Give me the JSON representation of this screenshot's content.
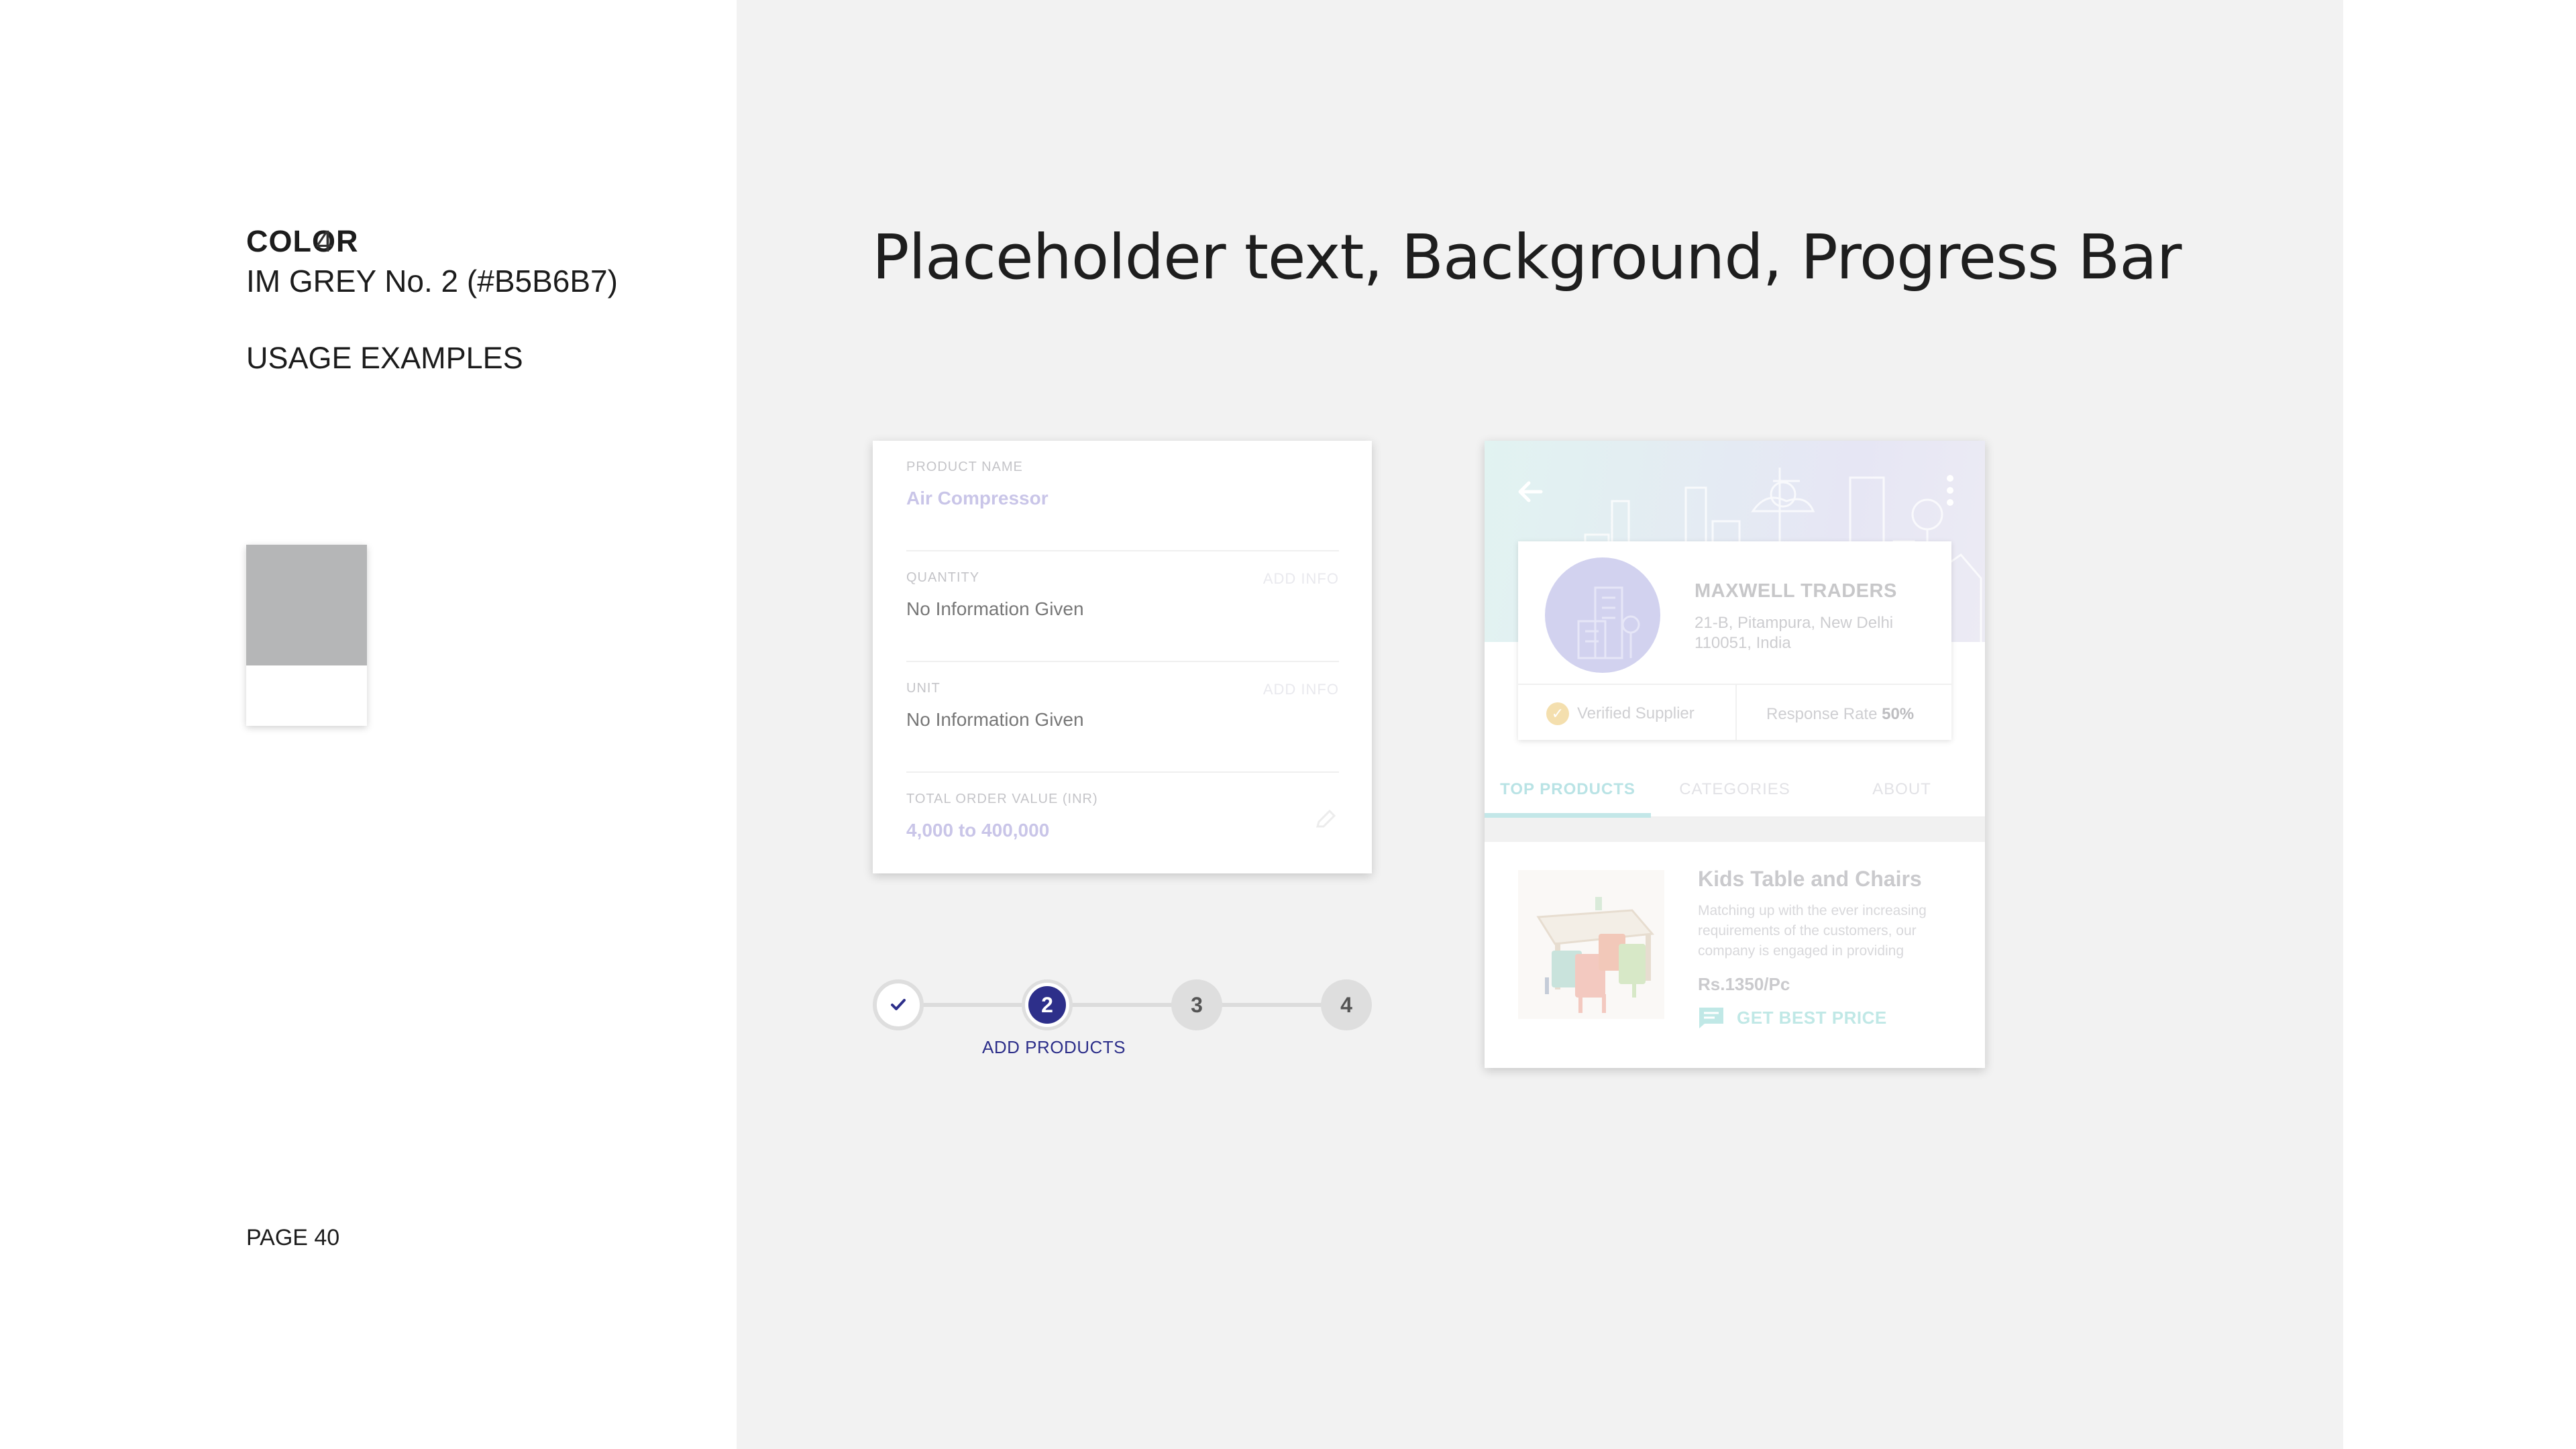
{
  "sidebar": {
    "color_label": "COLOR",
    "color_number": "4",
    "color_name": "IM GREY No. 2 (#B5B6B7)",
    "usage_label": "USAGE EXAMPLES",
    "swatch_color": "#B5B6B7",
    "page_number": "PAGE 40"
  },
  "main": {
    "title": "Placeholder text, Background, Progress Bar"
  },
  "form": {
    "fields": [
      {
        "label": "PRODUCT NAME",
        "value": "Air Compressor",
        "action": ""
      },
      {
        "label": "QUANTITY",
        "value": "No Information Given",
        "action": "ADD INFO"
      },
      {
        "label": "UNIT",
        "value": "No Information Given",
        "action": "ADD INFO"
      },
      {
        "label": "TOTAL ORDER VALUE (INR)",
        "value": "4,000 to 400,000",
        "action": ""
      }
    ]
  },
  "stepper": {
    "steps": [
      "",
      "2",
      "3",
      "4"
    ],
    "active_label": "ADD PRODUCTS",
    "active_color": "#2D2F8A"
  },
  "profile": {
    "company": "MAXWELL TRADERS",
    "address_line1": "21-B, Pitampura, New Delhi",
    "address_line2": "110051, India",
    "verified": "Verified Supplier",
    "response_label": "Response Rate",
    "response_value": "50%",
    "tabs": [
      "TOP PRODUCTS",
      "CATEGORIES",
      "ABOUT"
    ],
    "product": {
      "title": "Kids Table and Chairs",
      "desc_line1": "Matching up with the ever increasing",
      "desc_line2": "requirements of the customers, our",
      "desc_line3": "company is engaged in providing",
      "price": "Rs.1350/Pc",
      "cta": "GET BEST PRICE"
    }
  }
}
